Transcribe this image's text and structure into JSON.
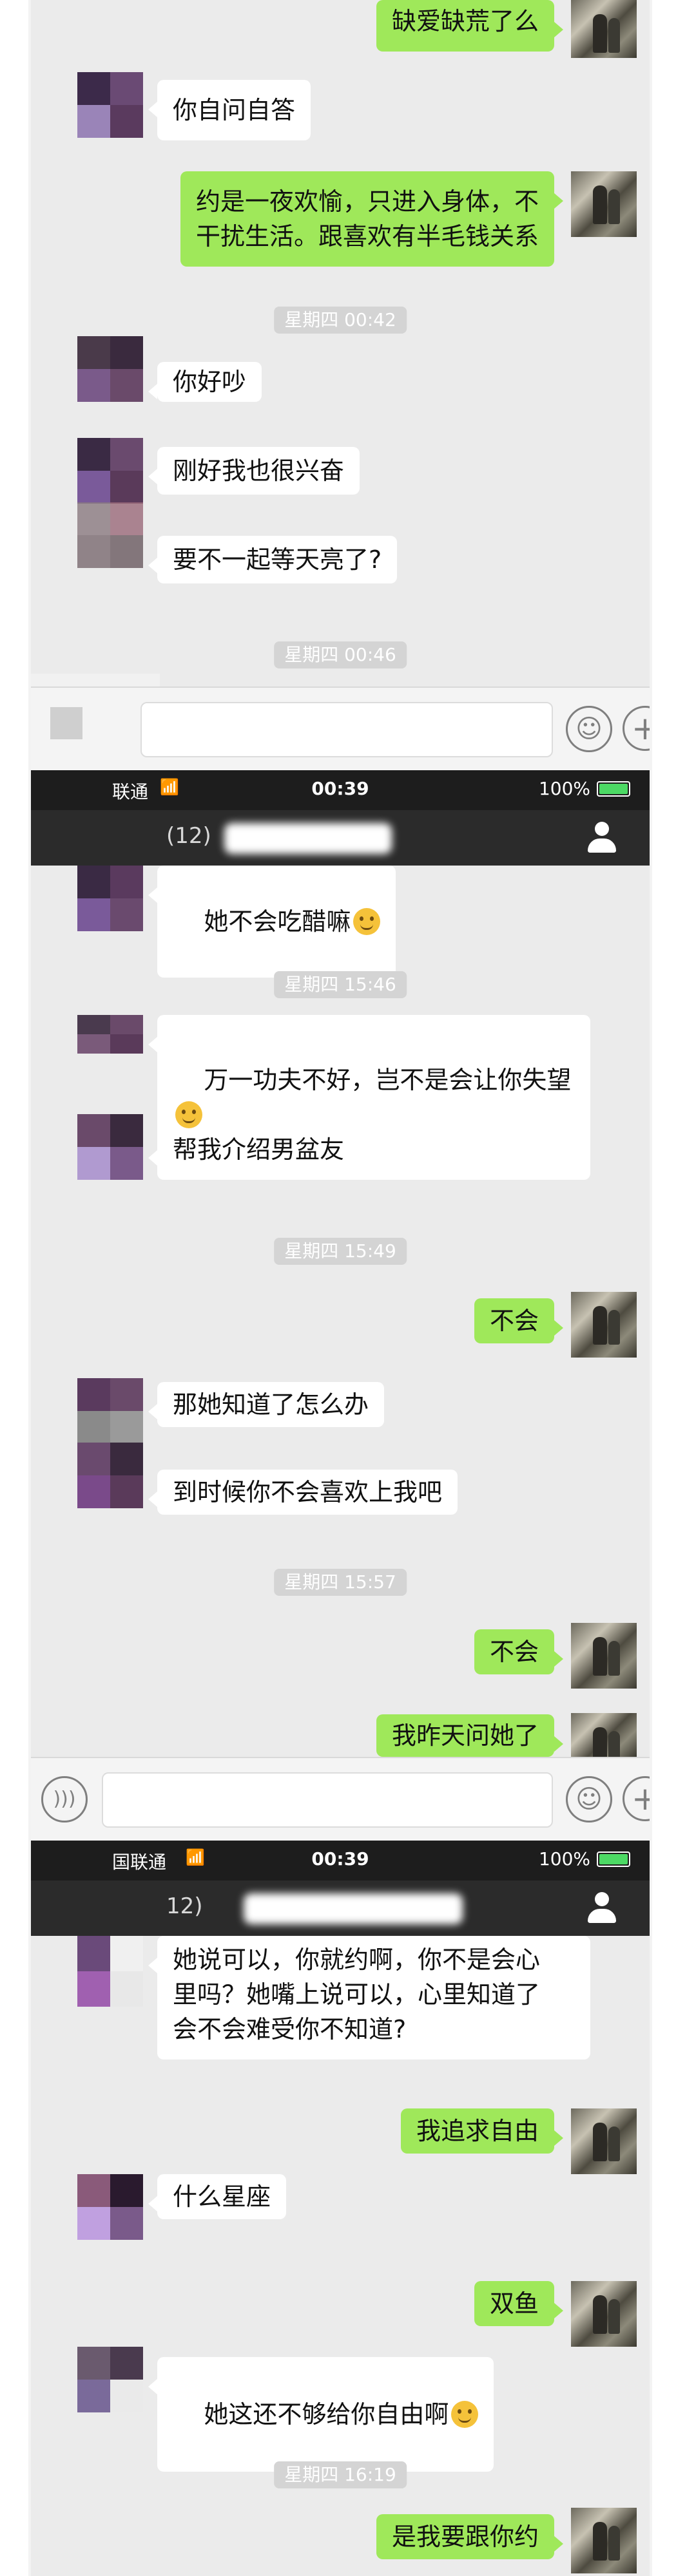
{
  "segment1": {
    "messages": [
      {
        "side": "out",
        "text": "缺爱缺荒了么"
      },
      {
        "side": "in",
        "text": "你自问自答"
      },
      {
        "side": "in",
        "text": "约是一夜欢愉，只进入身体，不\n干扰生活。跟喜欢有半毛钱关系"
      },
      {
        "side": "time",
        "text": "星期四 00:42"
      },
      {
        "side": "in",
        "text": "你好吵"
      },
      {
        "side": "in",
        "text": "刚好我也很兴奋"
      },
      {
        "side": "in",
        "text": "要不一起等天亮了?"
      },
      {
        "side": "time",
        "text": "星期四 00:46"
      }
    ]
  },
  "status": {
    "carrier": "联通",
    "carrier2": "国联通",
    "time": "00:39",
    "battery": "100%"
  },
  "nav": {
    "title": "(12)",
    "title2": "12)"
  },
  "segment2": {
    "messages": [
      {
        "side": "in",
        "text": "她不会吃醋嘛",
        "emoji": "thinking-emoji"
      },
      {
        "side": "time",
        "text": "星期四 15:46"
      },
      {
        "side": "in",
        "text": "万一功夫不好，岂不是会让你失望",
        "emoji": "grimace-emoji"
      },
      {
        "side": "in",
        "text": "帮我介绍男盆友"
      },
      {
        "side": "time",
        "text": "星期四 15:49"
      },
      {
        "side": "out",
        "text": "不会"
      },
      {
        "side": "in",
        "text": "那她知道了怎么办"
      },
      {
        "side": "in",
        "text": "到时候你不会喜欢上我吧"
      },
      {
        "side": "time",
        "text": "星期四 15:57"
      },
      {
        "side": "out",
        "text": "不会"
      },
      {
        "side": "out",
        "text": "我昨天问她了"
      }
    ]
  },
  "segment3": {
    "messages": [
      {
        "side": "in",
        "text": "她说可以，你就约啊，你不是会心\n里吗？她嘴上说可以，心里知道了\n会不会难受你不知道?"
      },
      {
        "side": "out",
        "text": "我追求自由"
      },
      {
        "side": "in",
        "text": "什么星座"
      },
      {
        "side": "out",
        "text": "双鱼"
      },
      {
        "side": "in",
        "text": "她这还不够给你自由啊",
        "emoji": "flushed-emoji"
      },
      {
        "side": "time",
        "text": "星期四 16:19"
      },
      {
        "side": "out",
        "text": "是我要跟你约"
      }
    ]
  },
  "icons": {
    "voice": "voice-icon",
    "emoji": "emoji-icon",
    "plus": "plus-icon",
    "wifi": "wifi-icon",
    "user": "user-icon"
  },
  "colors": {
    "outgoing": "#9fe85a",
    "incoming": "#ffffff",
    "background": "#ebebeb",
    "statusbar": "#1d1d1d",
    "navbar": "#2b2b2b"
  }
}
